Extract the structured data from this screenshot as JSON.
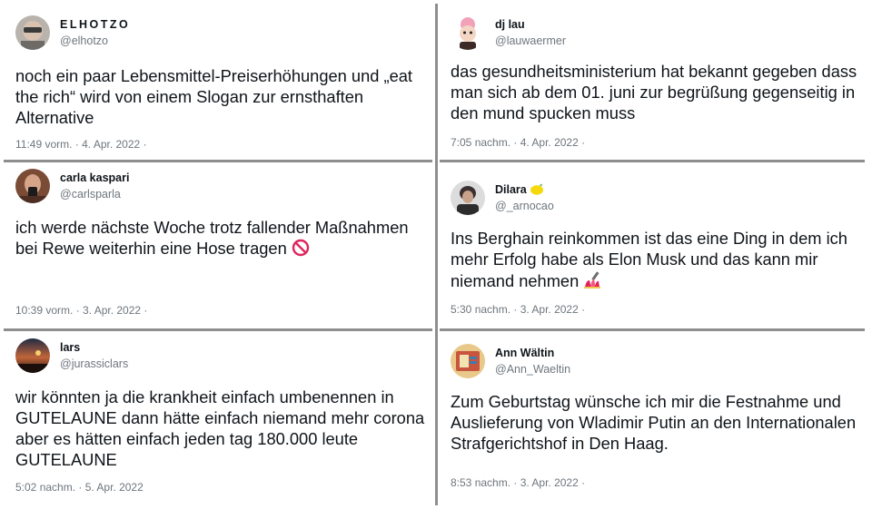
{
  "tweets": [
    {
      "display_name": "ELHOTZO",
      "handle": "@elhotzo",
      "text": "noch ein paar Lebensmittel-Preiserhöhungen und „eat the rich“ wird von einem Slogan zur ernsthaften Alternative",
      "timestamp": "11:49 vorm. · 4. Apr. 2022 ·"
    },
    {
      "display_name": "dj lau",
      "handle": "@lauwaermer",
      "text": "das gesundheitsministerium hat bekannt gegeben dass man sich ab dem 01. juni zur begrüßung gegenseitig in den mund spucken muss",
      "timestamp": "7:05 nachm. · 4. Apr. 2022 ·"
    },
    {
      "display_name": "carla kaspari",
      "handle": "@carlsparla",
      "text": "ich werde nächste Woche trotz fallender Maßnahmen bei Rewe weiterhin eine Hose tragen",
      "emoji": "prohibited-emoji",
      "timestamp": "10:39 vorm. · 3. Apr. 2022 ·"
    },
    {
      "display_name": "Dilara",
      "name_emoji": "lemon-emoji",
      "handle": "@_arnocao",
      "text": "Ins Berghain reinkommen ist das eine Ding in dem ich mehr Erfolg habe als Elon Musk und das kann mir niemand nehmen",
      "emoji": "nail-polish-emoji",
      "timestamp": "5:30 nachm. · 3. Apr. 2022 ·"
    },
    {
      "display_name": "lars",
      "handle": "@jurassiclars",
      "text": "wir könnten ja die krankheit einfach umbenennen in GUTELAUNE dann hätte einfach niemand mehr corona aber es hätten einfach jeden tag 180.000 leute GUTELAUNE",
      "timestamp": "5:02 nachm. · 5. Apr. 2022"
    },
    {
      "display_name": "Ann Wältin",
      "handle": "@Ann_Waeltin",
      "text": "Zum Geburtstag wünsche ich mir die Festnahme und Auslieferung von Wladimir Putin an den Internationalen Strafgerichtshof in Den Haag.",
      "timestamp": "8:53 nachm. · 3. Apr. 2022 ·"
    }
  ]
}
